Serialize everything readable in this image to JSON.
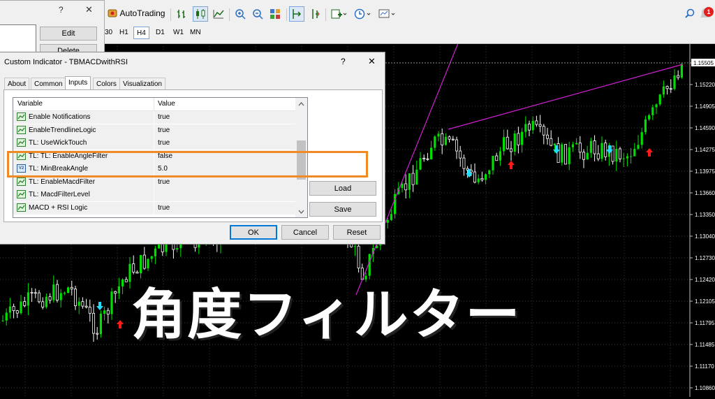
{
  "toolbar": {
    "autotrading_label": "AutoTrading",
    "timeframes": [
      {
        "label": "M30",
        "shown": "30",
        "active": false
      },
      {
        "label": "H1",
        "shown": "H1",
        "active": false
      },
      {
        "label": "H4",
        "shown": "H4",
        "active": true
      },
      {
        "label": "D1",
        "shown": "D1",
        "active": false
      },
      {
        "label": "W1",
        "shown": "W1",
        "active": false
      },
      {
        "label": "MN",
        "shown": "MN",
        "active": false
      }
    ],
    "notification_badge": "1"
  },
  "back_dialog": {
    "help_label": "?",
    "close_label": "✕",
    "edit_label": "Edit",
    "delete_label": "Delete"
  },
  "dialog": {
    "title": "Custom Indicator - TBMACDwithRSI",
    "help_label": "?",
    "close_label": "✕",
    "tabs": [
      "About",
      "Common",
      "Inputs",
      "Colors",
      "Visualization"
    ],
    "active_tab": "Inputs",
    "columns": {
      "variable": "Variable",
      "value": "Value"
    },
    "rows": [
      {
        "name": "Enable Notifications",
        "value": "true",
        "icon": "bool"
      },
      {
        "name": "EnableTrendlineLogic",
        "value": "true",
        "icon": "bool"
      },
      {
        "name": "TL: UseWickTouch",
        "value": "true",
        "icon": "bool"
      },
      {
        "name": "TL: TL: EnableAngleFilter",
        "value": "false",
        "icon": "bool"
      },
      {
        "name": "TL: MinBreakAngle",
        "value": "5.0",
        "icon": "double"
      },
      {
        "name": "TL: EnableMacdFilter",
        "value": "true",
        "icon": "bool"
      },
      {
        "name": "TL: MacdFilterLevel",
        "value": "",
        "icon": "bool"
      },
      {
        "name": "MACD + RSI Logic",
        "value": "true",
        "icon": "bool"
      }
    ],
    "icon_double_text": "V2",
    "load_label": "Load",
    "save_label": "Save",
    "ok_label": "OK",
    "cancel_label": "Cancel",
    "reset_label": "Reset"
  },
  "price_axis": {
    "labels": [
      "1.15505",
      "1.15220",
      "1.14905",
      "1.14590",
      "1.14275",
      "1.13975",
      "1.13660",
      "1.13350",
      "1.13040",
      "1.12730",
      "1.12420",
      "1.12105",
      "1.11795",
      "1.11485",
      "1.11170",
      "1.10860"
    ],
    "current_price": "1.15505"
  },
  "caption": "角度フィルター",
  "colors": {
    "bull": "#00e000",
    "bear": "#ffffff",
    "trendline": "#d020d0",
    "arrow_up": "#ff1a1a",
    "arrow_down": "#22ddff",
    "highlight": "#f08a24"
  }
}
